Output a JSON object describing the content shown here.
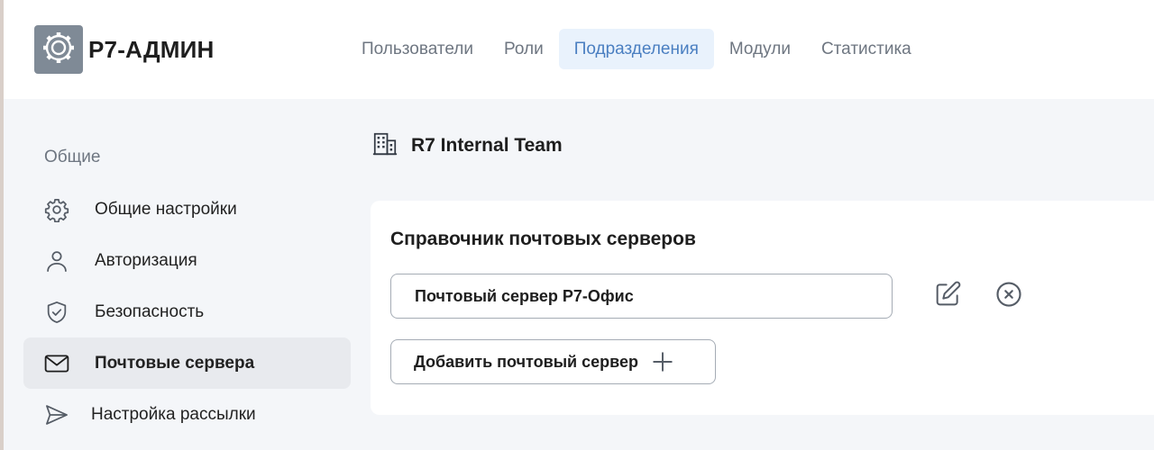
{
  "header": {
    "brand": "Р7-АДМИН",
    "logo_icon": "gear-icon",
    "nav": [
      {
        "label": "Пользователи",
        "active": false
      },
      {
        "label": "Роли",
        "active": false
      },
      {
        "label": "Подразделения",
        "active": true
      },
      {
        "label": "Модули",
        "active": false
      },
      {
        "label": "Статистика",
        "active": false
      }
    ]
  },
  "sidebar": {
    "section_title": "Общие",
    "items": [
      {
        "label": "Общие настройки",
        "icon": "gear-icon",
        "active": false
      },
      {
        "label": "Авторизация",
        "icon": "user-icon",
        "active": false
      },
      {
        "label": "Безопасность",
        "icon": "shield-check-icon",
        "active": false
      },
      {
        "label": "Почтовые сервера",
        "icon": "envelope-icon",
        "active": true
      },
      {
        "label": "Настройка рассылки",
        "icon": "send-icon",
        "active": false
      }
    ]
  },
  "main": {
    "org_name": "R7 Internal Team",
    "org_icon": "building-icon",
    "card": {
      "title": "Справочник почтовых серверов",
      "servers": [
        {
          "name": "Почтовый сервер Р7-Офис"
        }
      ],
      "add_button_label": "Добавить почтовый сервер"
    }
  },
  "colors": {
    "accent_text": "#4a7fc1",
    "accent_bg": "#e9f2fc",
    "logo_bg": "#7f8a96",
    "page_bg": "#f4f6f9"
  }
}
